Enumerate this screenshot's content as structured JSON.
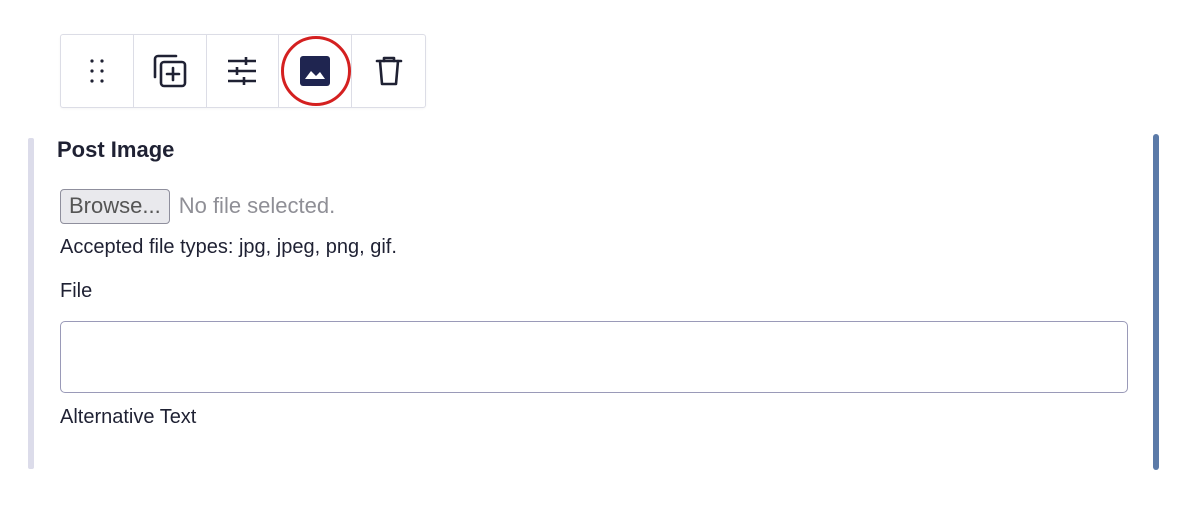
{
  "toolbar": {
    "buttons": [
      {
        "icon": "drag-handle-icon"
      },
      {
        "icon": "duplicate-icon"
      },
      {
        "icon": "settings-sliders-icon"
      },
      {
        "icon": "image-icon",
        "highlighted": true
      },
      {
        "icon": "trash-icon"
      }
    ],
    "highlight_color": "#d42020"
  },
  "field": {
    "title": "Post Image",
    "file_input": {
      "browse_label": "Browse...",
      "status": "No file selected."
    },
    "accepted_types": "Accepted file types: jpg, jpeg, png, gif.",
    "file_label": "File",
    "file_value": "",
    "alt_label": "Alternative Text"
  },
  "colors": {
    "text": "#1f2133",
    "accent_bar": "#5b7aa8",
    "left_bar": "#dcdcea"
  }
}
